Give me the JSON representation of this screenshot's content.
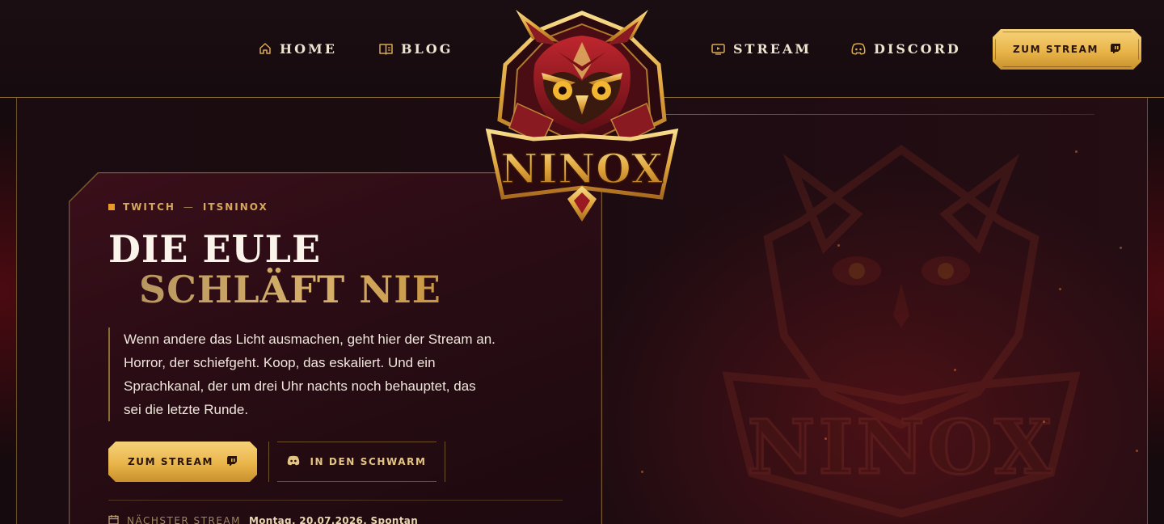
{
  "nav": {
    "items": [
      {
        "label": "HOME",
        "icon": "home-icon"
      },
      {
        "label": "BLOG",
        "icon": "book-icon"
      },
      {
        "label": "STREAM",
        "icon": "play-icon"
      },
      {
        "label": "DISCORD",
        "icon": "discord-icon"
      }
    ],
    "cta_label": "ZUM STREAM",
    "cta_icon": "twitch-icon"
  },
  "logo": {
    "text": "NINOX",
    "icon": "owl-emblem"
  },
  "hero": {
    "eyebrow_platform": "TWITCH",
    "eyebrow_separator": "—",
    "eyebrow_handle": "ITSNINOX",
    "title_line_1": "DIE EULE",
    "title_line_2": "SCHLÄFT NIE",
    "lede": "Wenn andere das Licht ausmachen, geht hier der Stream an. Horror, der schiefgeht. Koop, das eskaliert. Und ein Sprachkanal, der um drei Uhr nachts noch behauptet, das sei die letzte Runde.",
    "primary_button": "ZUM STREAM",
    "secondary_button": "IN DEN SCHWARM",
    "next_stream_label": "NÄCHSTER STREAM",
    "next_stream_value": "Montag, 20.07.2026, Spontan"
  },
  "colors": {
    "gold": "#e9b54a",
    "gold_light": "#f6d27a",
    "crimson": "#8a1a22",
    "background": "#150a0d",
    "border": "#8a6a35"
  }
}
